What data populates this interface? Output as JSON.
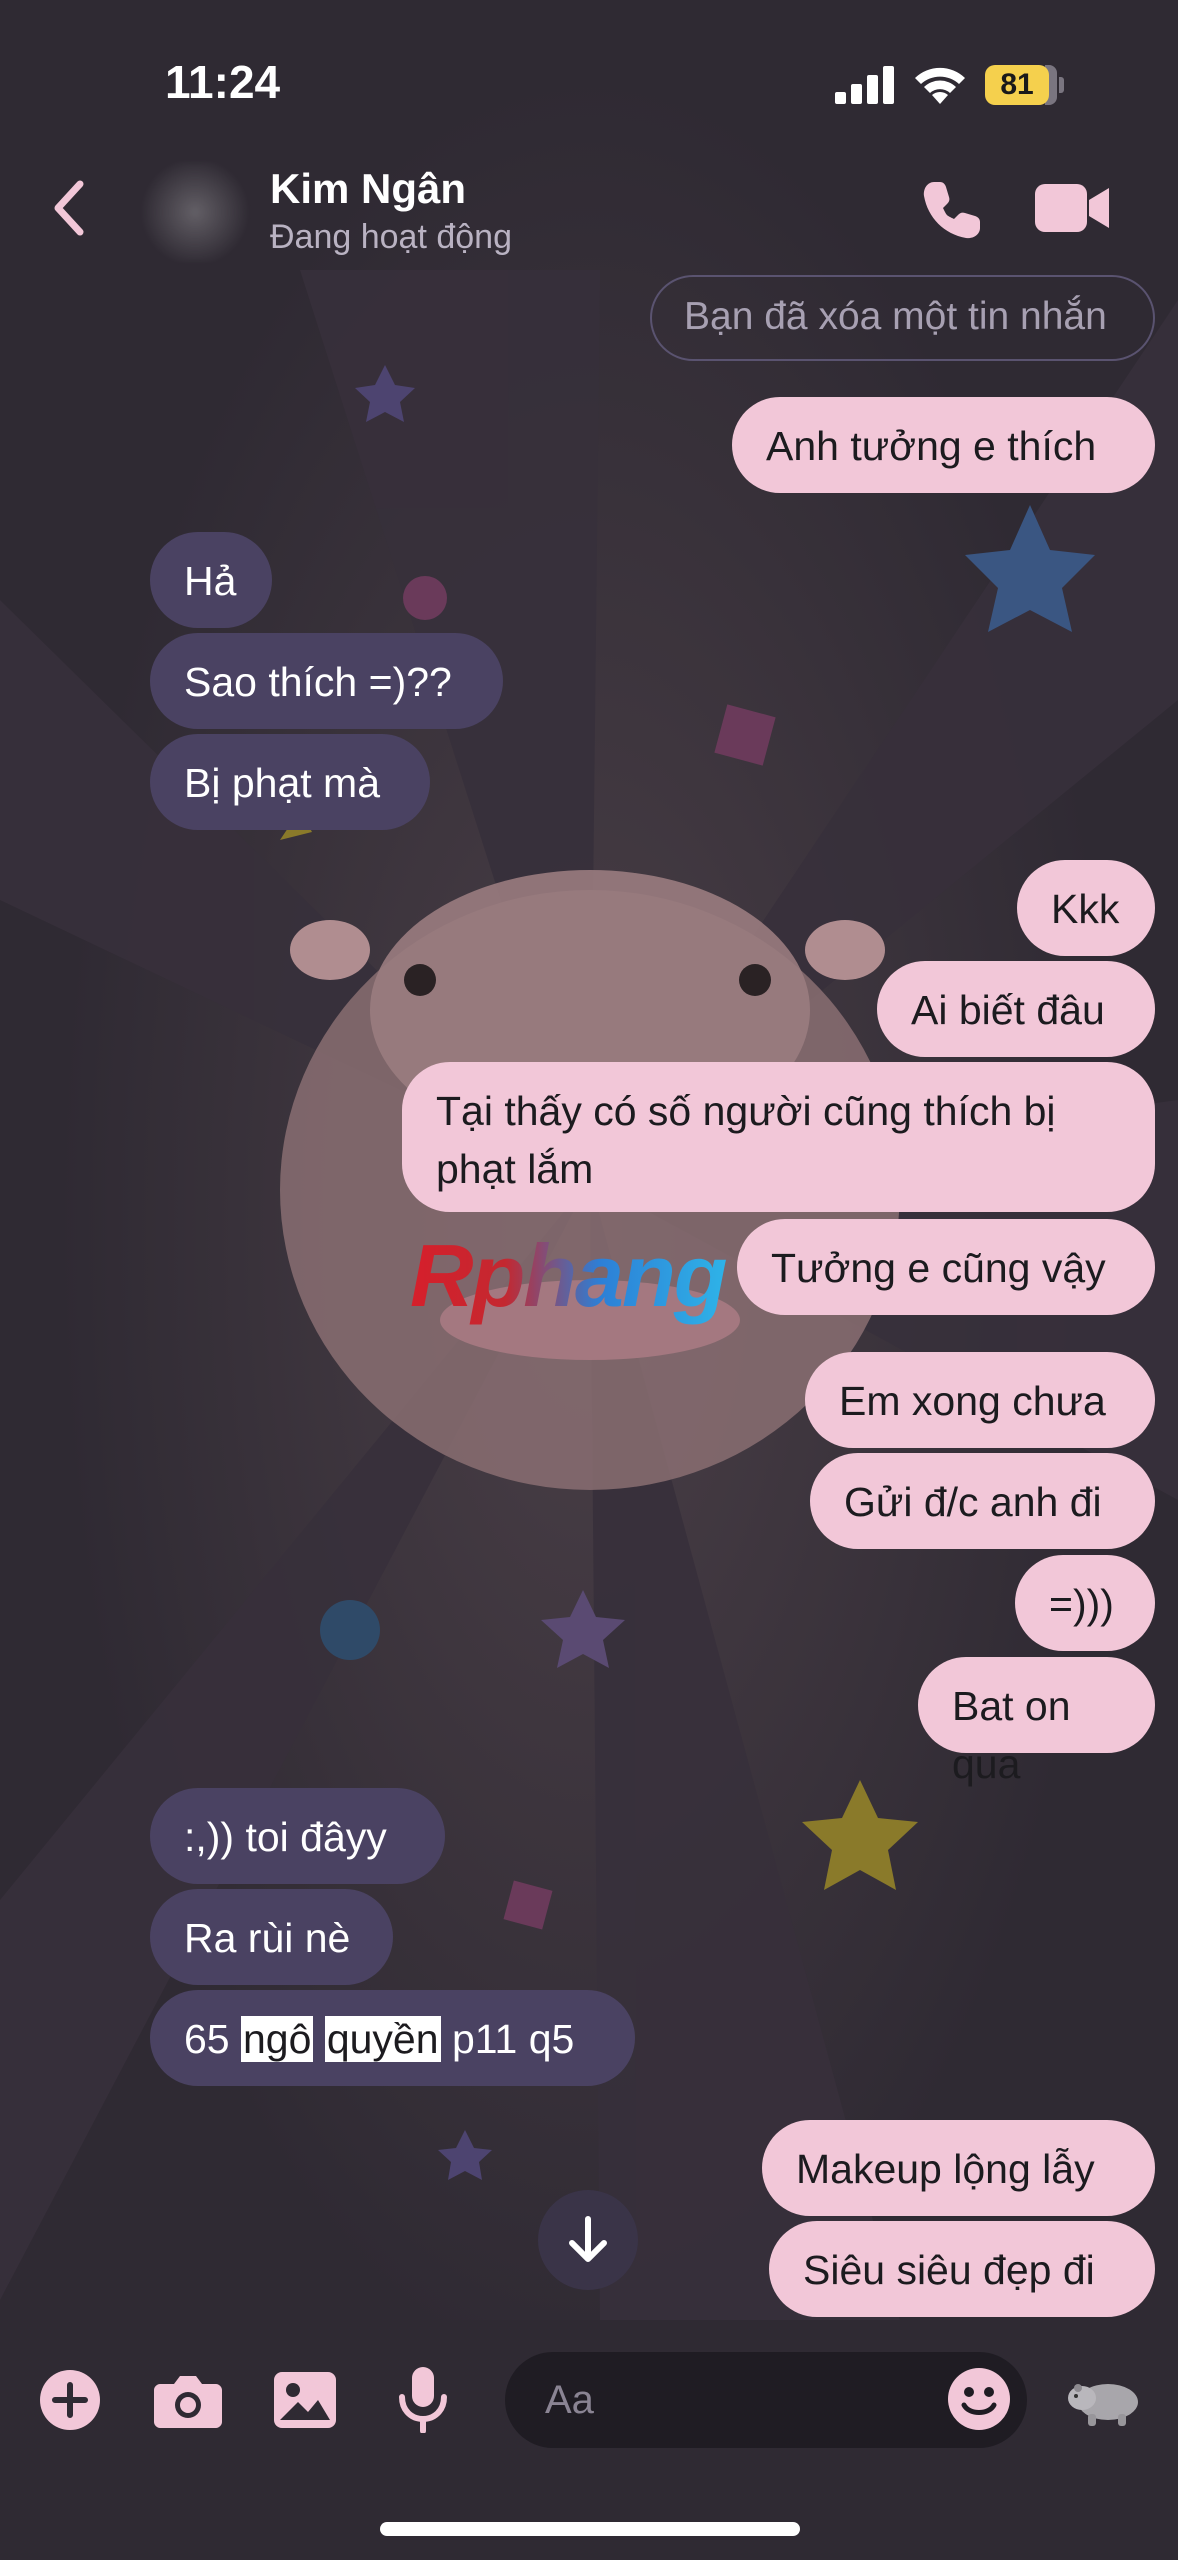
{
  "status_bar": {
    "time": "11:24",
    "battery": "81"
  },
  "header": {
    "contact_name": "Kim Ngân",
    "contact_status": "Đang hoạt động"
  },
  "messages": [
    {
      "dir": "out",
      "kind": "deleted",
      "text": "Bạn đã xóa một tin nhắn"
    },
    {
      "dir": "out",
      "text": "Anh tưởng e thích"
    },
    {
      "dir": "in",
      "text": "Hả"
    },
    {
      "dir": "in",
      "text": "Sao thích =)??"
    },
    {
      "dir": "in",
      "text": "Bị phạt mà"
    },
    {
      "dir": "out",
      "text": "Kkk"
    },
    {
      "dir": "out",
      "text": "Ai biết đâu"
    },
    {
      "dir": "out",
      "text": "Tại thấy có số người cũng thích bị phạt lắm"
    },
    {
      "dir": "out",
      "text": "Tưởng e cũng vậy"
    },
    {
      "dir": "out",
      "text": "Em xong chưa"
    },
    {
      "dir": "out",
      "text": "Gửi đ/c anh đi"
    },
    {
      "dir": "out",
      "text": "=)))"
    },
    {
      "dir": "out",
      "text": "Bat on qua"
    },
    {
      "dir": "in",
      "text": ":,)) toi đâyy"
    },
    {
      "dir": "in",
      "text": "Ra rùi nè"
    },
    {
      "dir": "in",
      "parts": [
        "65 ",
        "ngô",
        " ",
        "quyền",
        " p11 q5"
      ]
    },
    {
      "dir": "out",
      "text": "Makeup lộng lẫy"
    },
    {
      "dir": "out",
      "text": "Siêu siêu đẹp đi"
    }
  ],
  "watermark": "Rphang",
  "composer": {
    "placeholder": "Aa"
  },
  "colors": {
    "outgoing": "#f2c7d8",
    "incoming": "#4a4262",
    "accent": "#f2c7d8",
    "background": "#2f2a33"
  },
  "icons": [
    "back-icon",
    "phone-icon",
    "video-camera-icon",
    "arrow-down-icon",
    "plus-icon",
    "camera-icon",
    "image-icon",
    "microphone-icon",
    "emoji-icon",
    "hippo-icon"
  ]
}
